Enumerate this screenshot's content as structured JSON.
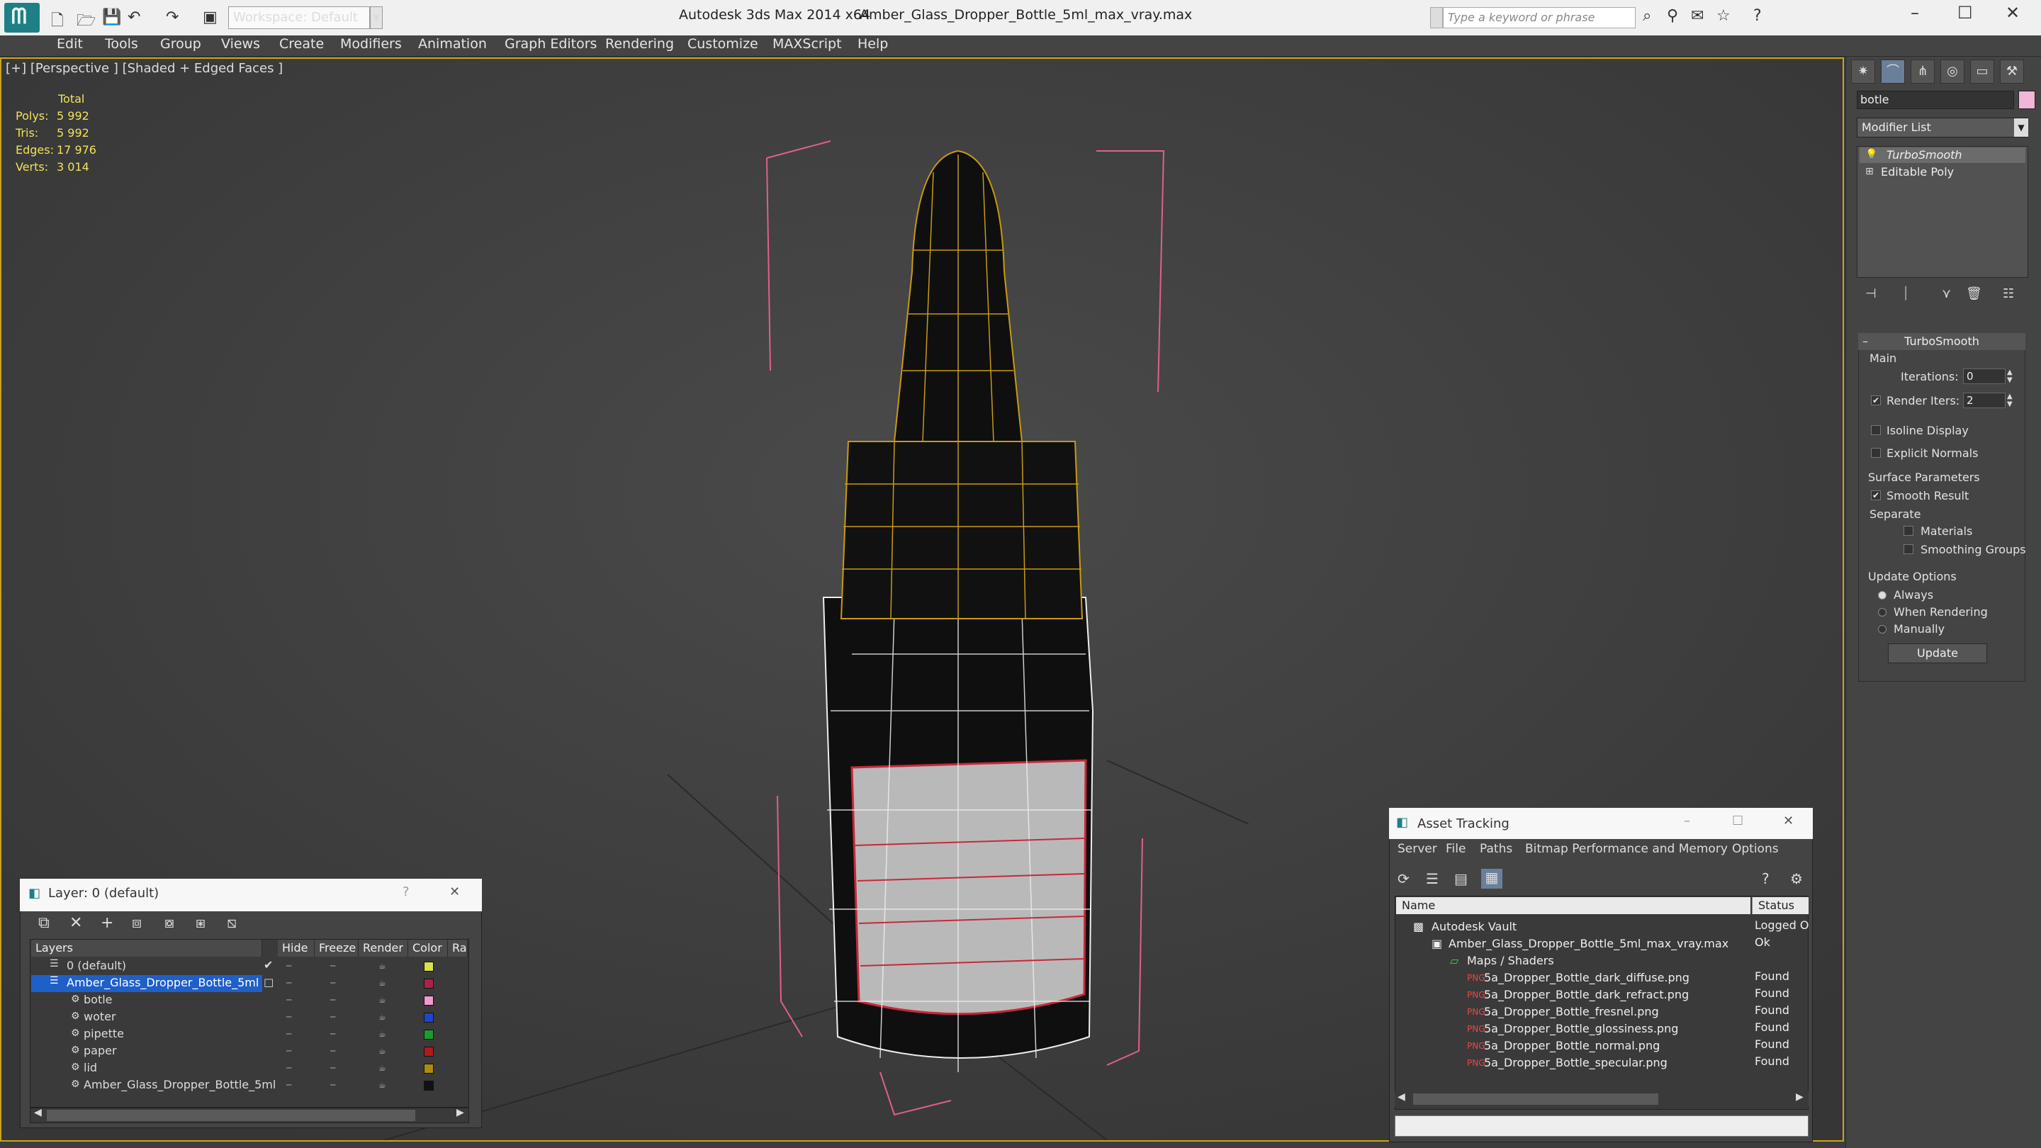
{
  "titlebar": {
    "workspace": "Workspace: Default",
    "app_title": "Autodesk 3ds Max  2014 x64",
    "file_title": "Amber_Glass_Dropper_Bottle_5ml_max_vray.max",
    "search_placeholder": "Type a keyword or phrase"
  },
  "menu": [
    "Edit",
    "Tools",
    "Group",
    "Views",
    "Create",
    "Modifiers",
    "Animation",
    "Graph Editors",
    "Rendering",
    "Customize",
    "MAXScript",
    "Help"
  ],
  "viewport": {
    "label": "[+] [Perspective ] [Shaded + Edged Faces ]",
    "stats_header": "Total",
    "stats": [
      {
        "label": "Polys:",
        "value": "5 992"
      },
      {
        "label": "Tris:",
        "value": "5 992"
      },
      {
        "label": "Edges:",
        "value": "17 976"
      },
      {
        "label": "Verts:",
        "value": "3 014"
      }
    ]
  },
  "command_panel": {
    "object_name": "botle",
    "object_color": "#f2b6d8",
    "modifier_list": "Modifier List",
    "stack": [
      "TurboSmooth",
      "Editable Poly"
    ],
    "turbosmooth": {
      "title": "TurboSmooth",
      "main": "Main",
      "iterations_label": "Iterations:",
      "iterations": "0",
      "render_iters_label": "Render Iters:",
      "render_iters": "2",
      "isoline": "Isoline Display",
      "explicit": "Explicit Normals",
      "surface_params": "Surface Parameters",
      "smooth_result": "Smooth Result",
      "separate": "Separate",
      "materials": "Materials",
      "smoothing_groups": "Smoothing Groups",
      "update_options": "Update Options",
      "always": "Always",
      "when_rendering": "When Rendering",
      "manually": "Manually",
      "update": "Update"
    }
  },
  "layers": {
    "title": "Layer: 0 (default)",
    "columns": [
      "Layers",
      "Hide",
      "Freeze",
      "Render",
      "Color",
      "Ra"
    ],
    "rows": [
      {
        "name": "0 (default)",
        "color": "#d8e04a"
      },
      {
        "name": "Amber_Glass_Dropper_Bottle_5ml",
        "color": "#b01f4a"
      },
      {
        "name": "botle",
        "color": "#f29ad0"
      },
      {
        "name": "woter",
        "color": "#2046c8"
      },
      {
        "name": "pipette",
        "color": "#1f9a2c"
      },
      {
        "name": "paper",
        "color": "#b01a1a"
      },
      {
        "name": "lid",
        "color": "#b08a10"
      },
      {
        "name": "Amber_Glass_Dropper_Bottle_5ml",
        "color": "#111111"
      }
    ]
  },
  "asset_tracking": {
    "title": "Asset Tracking",
    "menu": [
      "Server",
      "File",
      "Paths",
      "Bitmap Performance and Memory",
      "Options"
    ],
    "col_name": "Name",
    "col_status": "Status",
    "rows": [
      {
        "name": "Autodesk Vault",
        "status": "Logged O"
      },
      {
        "name": "Amber_Glass_Dropper_Bottle_5ml_max_vray.max",
        "status": "Ok"
      },
      {
        "name": "Maps / Shaders",
        "status": ""
      },
      {
        "name": "5a_Dropper_Bottle_dark_diffuse.png",
        "status": "Found"
      },
      {
        "name": "5a_Dropper_Bottle_dark_refract.png",
        "status": "Found"
      },
      {
        "name": "5a_Dropper_Bottle_fresnel.png",
        "status": "Found"
      },
      {
        "name": "5a_Dropper_Bottle_glossiness.png",
        "status": "Found"
      },
      {
        "name": "5a_Dropper_Bottle_normal.png",
        "status": "Found"
      },
      {
        "name": "5a_Dropper_Bottle_specular.png",
        "status": "Found"
      }
    ]
  }
}
